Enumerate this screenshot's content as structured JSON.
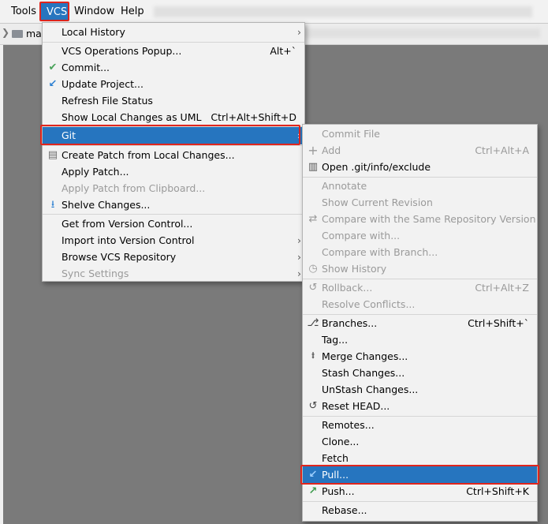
{
  "menubar": {
    "tools": "Tools",
    "vcs": "VCS",
    "window": "Window",
    "help": "Help"
  },
  "navbar": {
    "crumb": "ma"
  },
  "vcs_menu": {
    "items": [
      {
        "label": "Local History",
        "submenu": true
      },
      {
        "label": "VCS Operations Popup...",
        "shortcut": "Alt+`"
      },
      {
        "label": "Commit...",
        "icon": "check-icon"
      },
      {
        "label": "Update Project...",
        "icon": "update-arrow-icon"
      },
      {
        "label": "Refresh File Status"
      },
      {
        "label": "Show Local Changes as UML",
        "shortcut": "Ctrl+Alt+Shift+D"
      },
      {
        "label": "Git",
        "submenu": true,
        "selected": true
      },
      {
        "label": "Create Patch from Local Changes...",
        "icon": "patch-icon"
      },
      {
        "label": "Apply Patch..."
      },
      {
        "label": "Apply Patch from Clipboard...",
        "disabled": true
      },
      {
        "label": "Shelve Changes...",
        "icon": "shelve-icon"
      },
      {
        "label": "Get from Version Control..."
      },
      {
        "label": "Import into Version Control",
        "submenu": true
      },
      {
        "label": "Browse VCS Repository",
        "submenu": true
      },
      {
        "label": "Sync Settings",
        "disabled": true,
        "submenu": true
      }
    ]
  },
  "git_menu": {
    "items": [
      {
        "label": "Commit File",
        "disabled": true
      },
      {
        "label": "Add",
        "shortcut": "Ctrl+Alt+A",
        "disabled": true,
        "icon": "plus-icon"
      },
      {
        "label": "Open .git/info/exclude",
        "icon": "file-icon"
      },
      {
        "label": "Annotate",
        "disabled": true
      },
      {
        "label": "Show Current Revision",
        "disabled": true
      },
      {
        "label": "Compare with the Same Repository Version",
        "disabled": true,
        "icon": "compare-icon"
      },
      {
        "label": "Compare with...",
        "disabled": true
      },
      {
        "label": "Compare with Branch...",
        "disabled": true
      },
      {
        "label": "Show History",
        "disabled": true,
        "icon": "history-icon"
      },
      {
        "label": "Rollback...",
        "shortcut": "Ctrl+Alt+Z",
        "disabled": true,
        "icon": "rollback-icon"
      },
      {
        "label": "Resolve Conflicts...",
        "disabled": true
      },
      {
        "label": "Branches...",
        "shortcut": "Ctrl+Shift+`",
        "icon": "branch-icon"
      },
      {
        "label": "Tag..."
      },
      {
        "label": "Merge Changes...",
        "icon": "merge-icon"
      },
      {
        "label": "Stash Changes..."
      },
      {
        "label": "UnStash Changes..."
      },
      {
        "label": "Reset HEAD...",
        "icon": "reset-icon"
      },
      {
        "label": "Remotes..."
      },
      {
        "label": "Clone..."
      },
      {
        "label": "Fetch"
      },
      {
        "label": "Pull...",
        "selected": true,
        "icon": "pull-icon"
      },
      {
        "label": "Push...",
        "shortcut": "Ctrl+Shift+K",
        "icon": "push-icon"
      },
      {
        "label": "Rebase..."
      }
    ]
  },
  "colors": {
    "selection": "#2675bf",
    "highlight_box": "#e0251d",
    "menu_bg": "#f2f2f2",
    "disabled_text": "#9a9a9a"
  }
}
